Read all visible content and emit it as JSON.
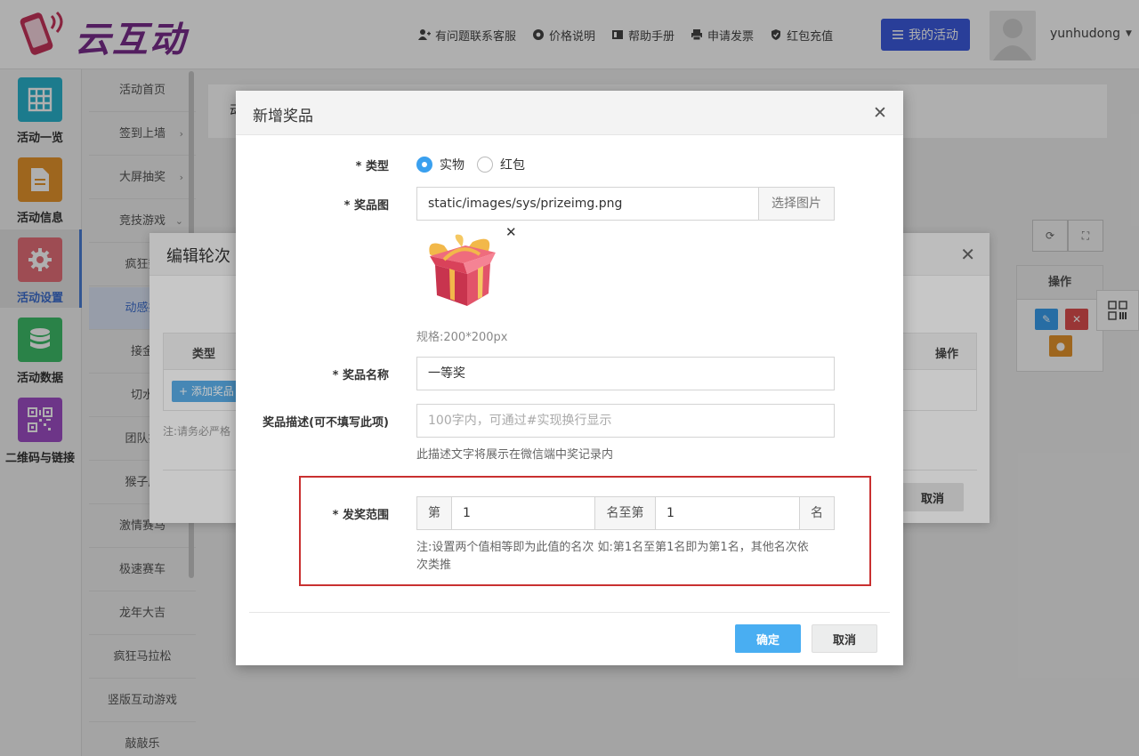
{
  "header": {
    "logo_text": "云互动",
    "nav": [
      {
        "label": "有问题联系客服",
        "icon": "user-plus-icon"
      },
      {
        "label": "价格说明",
        "icon": "gear-icon"
      },
      {
        "label": "帮助手册",
        "icon": "book-icon"
      },
      {
        "label": "申请发票",
        "icon": "printer-icon"
      },
      {
        "label": "红包充值",
        "icon": "shield-check-icon"
      }
    ],
    "my_activity": "我的活动",
    "username": "yunhudong"
  },
  "leftbar": [
    {
      "label": "活动一览",
      "icon": "grid-icon",
      "color": "#2ab4cf"
    },
    {
      "label": "活动信息",
      "icon": "document-icon",
      "color": "#e8962d"
    },
    {
      "label": "活动设置",
      "icon": "gear-icon",
      "color": "#e8707a"
    },
    {
      "label": "活动数据",
      "icon": "database-icon",
      "color": "#3ebf6a"
    },
    {
      "label": "二维码与链接",
      "icon": "qrcode-icon",
      "color": "#a04fc8"
    }
  ],
  "subbar": [
    {
      "label": "活动首页",
      "chevron": ""
    },
    {
      "label": "签到上墙",
      "chevron": "›"
    },
    {
      "label": "大屏抽奖",
      "chevron": "›"
    },
    {
      "label": "竞技游戏",
      "chevron": "⌄"
    },
    {
      "label": "疯狂数",
      "chevron": ""
    },
    {
      "label": "动感摇",
      "chevron": ""
    },
    {
      "label": "接金",
      "chevron": ""
    },
    {
      "label": "切水",
      "chevron": ""
    },
    {
      "label": "团队拔",
      "chevron": ""
    },
    {
      "label": "猴子爬",
      "chevron": ""
    },
    {
      "label": "激情赛马",
      "chevron": ""
    },
    {
      "label": "极速赛车",
      "chevron": ""
    },
    {
      "label": "龙年大吉",
      "chevron": ""
    },
    {
      "label": "疯狂马拉松",
      "chevron": ""
    },
    {
      "label": "竖版互动游戏",
      "chevron": ""
    },
    {
      "label": "敲敲乐",
      "chevron": ""
    }
  ],
  "background": {
    "main_prefix": "动",
    "op_header": "操作"
  },
  "edit_round_dialog": {
    "title": "编辑轮次",
    "col_type": "类型",
    "col_op": "操作",
    "add_prize": "+ 添加奖品",
    "note": "注:请务必严格",
    "cancel": "取消"
  },
  "dialog": {
    "title": "新增奖品",
    "type_label": "* 类型",
    "type_options": [
      "实物",
      "红包"
    ],
    "type_selected": "实物",
    "image_label": "* 奖品图",
    "image_path": "static/images/sys/prizeimg.png",
    "choose_image": "选择图片",
    "image_spec": "规格:200*200px",
    "name_label": "* 奖品名称",
    "name_value": "一等奖",
    "desc_label": "奖品描述(可不填写此项)",
    "desc_placeholder": "100字内，可通过#实现换行显示",
    "desc_hint": "此描述文字将展示在微信端中奖记录内",
    "range_label": "* 发奖范围",
    "range_prefix": "第",
    "range_from": "1",
    "range_mid": "名至第",
    "range_to": "1",
    "range_suffix": "名",
    "range_note_line1": "注:设置两个值相等即为此值的名次 如:第1名至第1名即为第1名，其他名次依",
    "range_note_line2": "次类推",
    "ok": "确定",
    "cancel": "取消"
  }
}
